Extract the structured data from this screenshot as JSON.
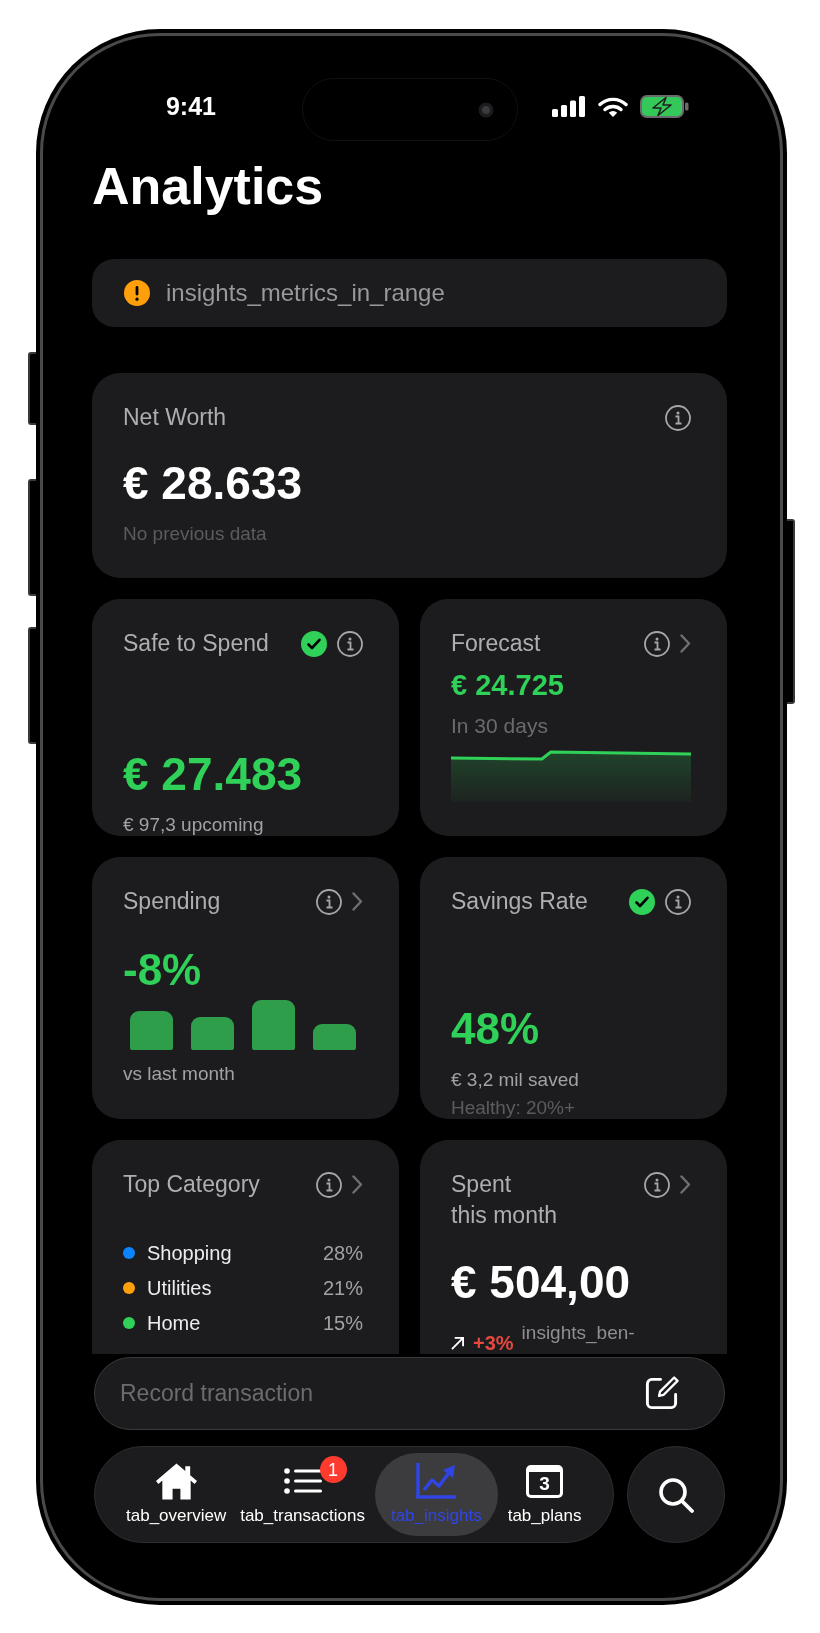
{
  "status_bar": {
    "time": "9:41"
  },
  "title": "Analytics",
  "banner": {
    "kind": "warning",
    "text": "insights_metrics_in_range"
  },
  "cards": [
    {
      "kind": "net_worth",
      "title": "Net Worth",
      "status_ok": false,
      "info": true,
      "chevron": false,
      "value": "€ 28.633",
      "positive": false,
      "note": "No previous data"
    },
    {
      "kind": "safe_to_spend",
      "title": "Safe to Spend",
      "status_ok": true,
      "info": true,
      "chevron": false,
      "value": "€ 27.483",
      "positive": true,
      "subtitle": "€ 97,3 upcoming"
    },
    {
      "kind": "forecast",
      "title": "Forecast",
      "status_ok": false,
      "info": true,
      "chevron": true,
      "value": "€ 24.725",
      "positive": true,
      "note": "In 30 days"
    },
    {
      "kind": "spending",
      "title": "Spending",
      "status_ok": false,
      "info": true,
      "chevron": true,
      "value": "-8%",
      "positive": true,
      "subtitle": "vs last month"
    },
    {
      "kind": "savings_rate",
      "title": "Savings Rate",
      "status_ok": true,
      "info": true,
      "chevron": false,
      "value": "48%",
      "positive": true,
      "subtitle": "€ 3,2 mil saved",
      "note": "Healthy: 20%+"
    },
    {
      "kind": "top_category",
      "title": "Top Category",
      "status_ok": false,
      "info": true,
      "chevron": true,
      "items": [
        {
          "name": "Shopping",
          "share": "28%",
          "color": "#0a84ff"
        },
        {
          "name": "Utilities",
          "share": "21%",
          "color": "#ff9f0a"
        },
        {
          "name": "Home",
          "share": "15%",
          "color": "#30d158"
        }
      ]
    },
    {
      "kind": "spent_this_month",
      "title": "Spent\nthis month",
      "status_ok": false,
      "info": true,
      "chevron": true,
      "value": "€ 504,00",
      "positive": false,
      "change": {
        "increase": true,
        "text": "+3%",
        "label": "insights_ben-"
      }
    }
  ],
  "record_field": {
    "placeholder": "Record transaction"
  },
  "tabs": [
    {
      "label": "tab_overview",
      "selected": false
    },
    {
      "label": "tab_transactions",
      "badge": "1",
      "selected": false
    },
    {
      "label": "tab_insights",
      "selected": true
    },
    {
      "label": "tab_plans",
      "day": "3",
      "selected": false
    }
  ]
}
